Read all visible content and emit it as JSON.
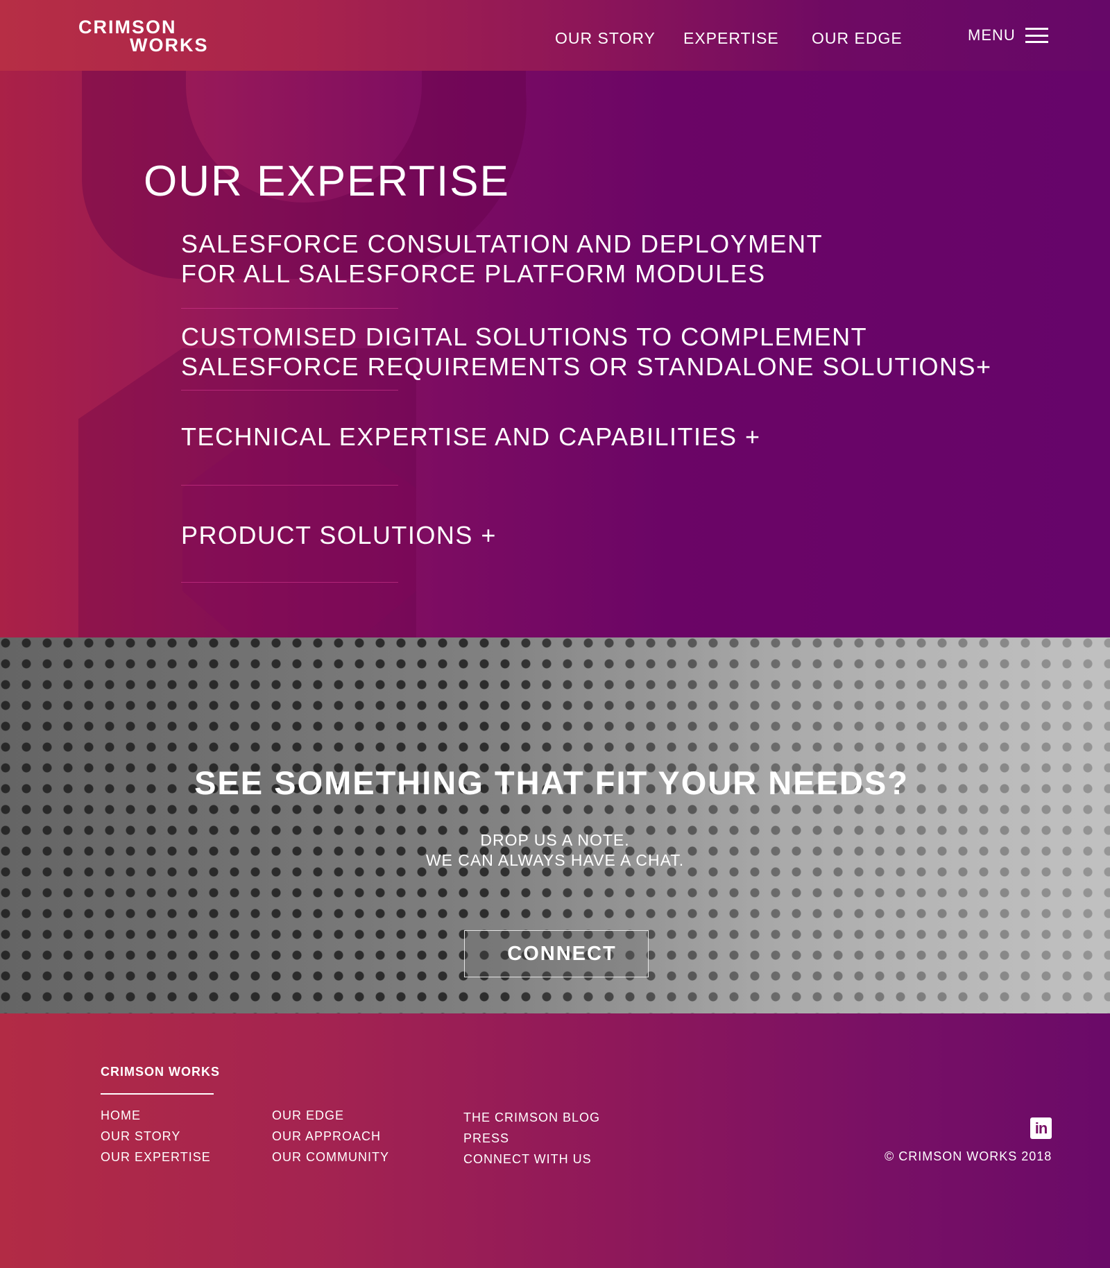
{
  "header": {
    "logo_line1": "CRIMSON",
    "logo_line2": "WORKS",
    "nav": [
      "OUR STORY",
      "EXPERTISE",
      "OUR EDGE"
    ],
    "menu_label": "MENU",
    "menu_icon": "hamburger-icon"
  },
  "expertise": {
    "title": "OUR EXPERTISE",
    "items": [
      {
        "lines": [
          "SALESFORCE CONSULTATION AND DEPLOYMENT",
          "FOR ALL SALESFORCE PLATFORM MODULES"
        ]
      },
      {
        "lines": [
          "CUSTOMISED DIGITAL SOLUTIONS TO COMPLEMENT",
          "SALESFORCE REQUIREMENTS OR STANDALONE SOLUTIONS+"
        ]
      },
      {
        "lines": [
          "TECHNICAL EXPERTISE AND CAPABILITIES +"
        ]
      },
      {
        "lines": [
          "PRODUCT SOLUTIONS +"
        ]
      }
    ]
  },
  "cta": {
    "title": "SEE SOMETHING THAT FIT YOUR NEEDS?",
    "sub_line1": "DROP US A NOTE.",
    "sub_line2": "WE CAN ALWAYS HAVE A CHAT.",
    "button": "CONNECT"
  },
  "footer": {
    "brand": "CRIMSON WORKS",
    "col1": [
      "HOME",
      "OUR STORY",
      "OUR EXPERTISE"
    ],
    "col2": [
      "OUR EDGE",
      "OUR APPROACH",
      "OUR COMMUNITY"
    ],
    "col3": [
      "THE CRIMSON BLOG",
      "PRESS",
      "CONNECT WITH US"
    ],
    "social_icon": "linkedin-icon",
    "social_glyph": "in",
    "copyright": "© CRIMSON WORKS 2018"
  },
  "colors": {
    "brand_crimson": "#b72e45",
    "brand_purple": "#660868"
  }
}
